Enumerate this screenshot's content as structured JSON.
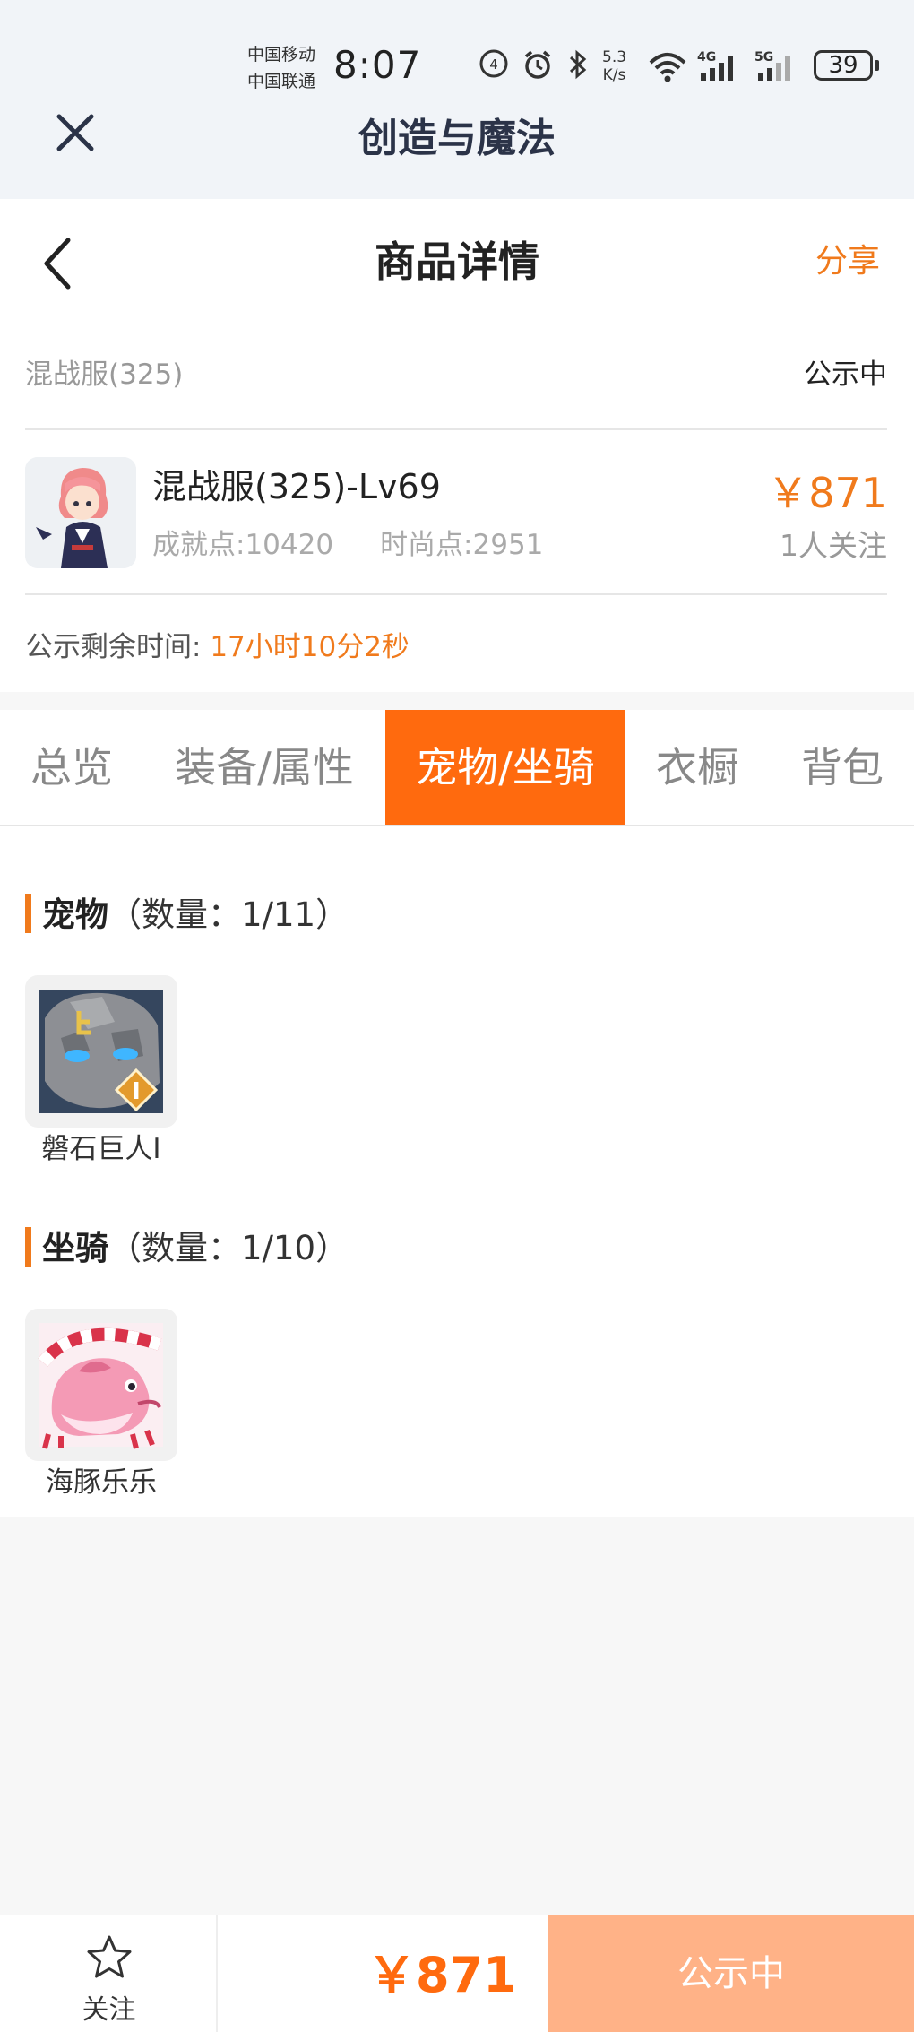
{
  "status_bar": {
    "carrier_1": "中国移动",
    "carrier_2": "中国联通",
    "time": "8:07",
    "net_speed_value": "5.3",
    "net_speed_unit": "K/s",
    "network_1": "4G",
    "network_2": "5G",
    "battery": "39"
  },
  "mini_app": {
    "title": "创造与魔法"
  },
  "header": {
    "title": "商品详情",
    "share_label": "分享"
  },
  "listing": {
    "server": "混战服(325)",
    "status": "公示中",
    "name": "混战服(325)-Lv69",
    "achievement": "成就点:10420",
    "fashion": "时尚点:2951",
    "price": "￥871",
    "followers": "1人关注",
    "remaining_label": "公示剩余时间:",
    "remaining_value": "17小时10分2秒"
  },
  "tabs": [
    {
      "label": "总览",
      "active": false
    },
    {
      "label": "装备/属性",
      "active": false
    },
    {
      "label": "宠物/坐骑",
      "active": true
    },
    {
      "label": "衣橱",
      "active": false
    },
    {
      "label": "背包",
      "active": false
    }
  ],
  "pets": {
    "title": "宠物",
    "count": "（数量：1/11）",
    "items": [
      {
        "name": "磐石巨人Ⅰ",
        "icon": "rock-giant-icon",
        "badge": "I"
      }
    ]
  },
  "mounts": {
    "title": "坐骑",
    "count": "（数量：1/10）",
    "items": [
      {
        "name": "海豚乐乐",
        "icon": "dolphin-icon"
      }
    ]
  },
  "bottom_bar": {
    "follow_label": "关注",
    "price": "￥871",
    "action_label": "公示中"
  },
  "colors": {
    "accent": "#f07a1c",
    "active_tab": "#ff6a0e",
    "action_button": "#ffb287",
    "title_bar_bg": "#f1f4f8"
  }
}
